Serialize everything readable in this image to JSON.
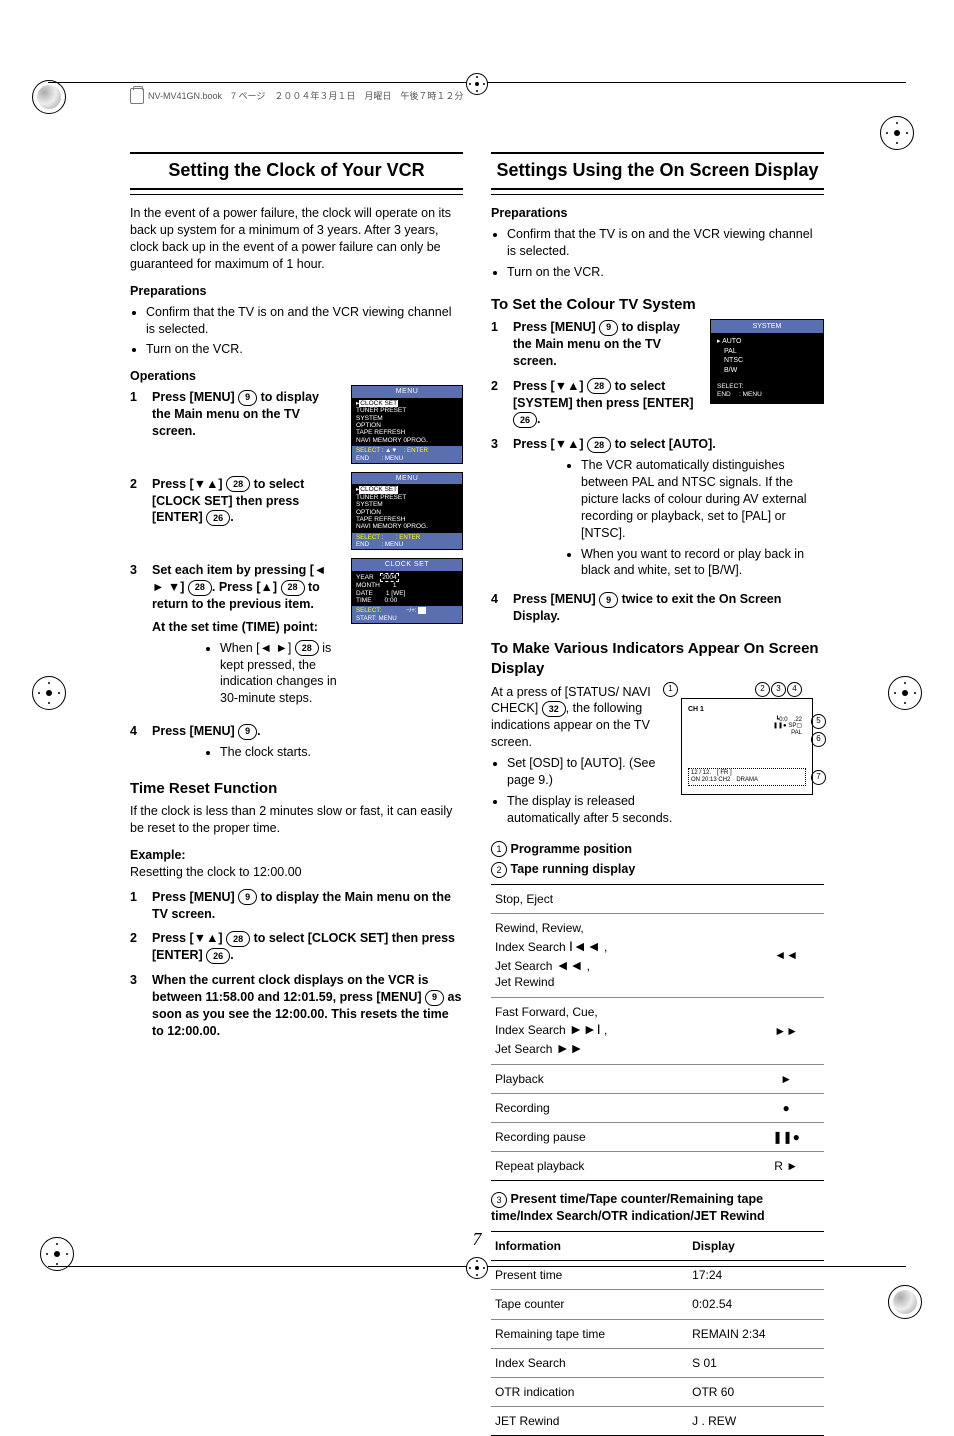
{
  "book_header": "NV-MV41GN.book　7 ページ　２００４年３月１日　月曜日　午後７時１２分",
  "page_number": "7",
  "left": {
    "title": "Setting the Clock of Your VCR",
    "intro": "In the event of a power failure, the clock will operate on its back up system for a minimum of 3 years. After 3 years, clock back up in the event of a power failure can only be guaranteed for maximum of 1 hour.",
    "prep_heading": "Preparations",
    "prep_items": [
      "Confirm that the TV is on and the VCR viewing channel is selected.",
      "Turn on the VCR."
    ],
    "ops_heading": "Operations",
    "steps": [
      {
        "num": "1",
        "textA": "Press [MENU] ",
        "btn": "9",
        "textB": " to display the Main menu on the TV screen."
      },
      {
        "num": "2",
        "textA": "Press [▼▲] ",
        "btn": "28",
        "textB": " to select [CLOCK SET] then press [ENTER] ",
        "btn2": "26",
        "textC": "."
      },
      {
        "num": "3",
        "textA": "Set each item by pressing [◄ ► ▼] ",
        "btn": "28",
        "textB": ". Press [▲] ",
        "btn2": "28",
        "textC": " to return to the previous item.",
        "subhead": "At the set time (TIME) point:",
        "subnote_a": "When [◄ ►] ",
        "subbtn": "28",
        "subnote_b": " is kept pressed, the indication changes in 30-minute steps."
      },
      {
        "num": "4",
        "textA": "Press [MENU] ",
        "btn": "9",
        "textB": ".",
        "subnote": "The clock starts."
      }
    ],
    "time_reset_heading": "Time Reset Function",
    "time_reset_body": "If the clock is less than 2 minutes slow or fast, it can easily be reset to the proper time.",
    "example_heading": "Example:",
    "example_desc": "Resetting the clock to 12:00.00",
    "example_steps": [
      {
        "num": "1",
        "a": "Press [MENU] ",
        "btn": "9",
        "b": " to display the Main menu on the TV screen."
      },
      {
        "num": "2",
        "a": "Press [▼▲] ",
        "btn": "28",
        "b": " to select [CLOCK SET] then press [ENTER] ",
        "btn2": "26",
        "c": "."
      },
      {
        "num": "3",
        "a": "When the current clock displays on the VCR is between 11:58.00 and 12:01.59, press [MENU] ",
        "btn": "9",
        "b": " as soon as you see the 12:00.00. This resets the time to 12:00.00."
      }
    ],
    "menu1": {
      "title": "MENU",
      "items": [
        "CLOCK SET",
        "TUNER PRESET",
        "SYSTEM",
        "OPTION",
        "TAPE REFRESH",
        "NAVI MEMORY 0PROG."
      ],
      "foot": [
        "SELECT : ▲▼　: ENTER",
        "END　　: MENU"
      ]
    },
    "menu2": {
      "title": "MENU",
      "items": [
        "CLOCK SET",
        "TUNER PRESET",
        "SYSTEM",
        "OPTION",
        "TAPE REFRESH",
        "NAVI MEMORY 0PROG."
      ],
      "foot": [
        "SELECT :　　: ENTER",
        "END　　: MENU"
      ]
    },
    "clockset": {
      "title": "CLOCK  SET",
      "rows": [
        [
          "YEAR",
          "2004"
        ],
        [
          "MONTH",
          "1"
        ],
        [
          "DATE",
          "1 [WE]"
        ],
        [
          "TIME",
          "0:00"
        ]
      ],
      "foot": [
        "SELECT:　　　　−/+:",
        "START: MENU"
      ]
    }
  },
  "right": {
    "title": "Settings Using the On Screen Display",
    "prep_heading": "Preparations",
    "prep_items": [
      "Confirm that the TV is on and the VCR viewing channel is selected.",
      "Turn on the VCR."
    ],
    "colour_heading": "To Set the Colour TV System",
    "colour_steps": [
      {
        "num": "1",
        "a": "Press [MENU] ",
        "btn": "9",
        "b": " to display the Main menu on the TV screen."
      },
      {
        "num": "2",
        "a": "Press [▼▲] ",
        "btn": "28",
        "b": " to select [SYSTEM] then press [ENTER] ",
        "btn2": "26",
        "c": "."
      },
      {
        "num": "3",
        "a": "Press [▼▲] ",
        "btn": "28",
        "b": " to  select [AUTO].",
        "subs": [
          "The VCR automatically distinguishes between PAL and NTSC signals. If the picture lacks of colour during AV external recording or playback, set to [PAL] or [NTSC].",
          "When you want to record or play back in black and white, set to [B/W]."
        ]
      },
      {
        "num": "4",
        "a": "Press [MENU] ",
        "btn": "9",
        "b": " twice to exit the On Screen Display."
      }
    ],
    "sysbox": {
      "title": "SYSTEM",
      "items": [
        "AUTO",
        "PAL",
        "NTSC",
        "B/W"
      ],
      "foot": [
        "SELECT:",
        "END　  : MENU"
      ]
    },
    "indic_heading": "To Make Various Indicators Appear On Screen Display",
    "indic_p1a": "At a press of [STATUS/ NAVI CHECK] ",
    "indic_btn": "32",
    "indic_p1b": ", the following indications appear on the TV screen.",
    "indic_bullets": [
      "Set [OSD] to [AUTO]. (See page 9.)",
      "The display is released automatically after 5 seconds."
    ],
    "osd_labels": {
      "ch": "CH 1",
      "counter": "0:0",
      "idx": ".22",
      "sp": "SP",
      "pal": "PAL",
      "row2": "12 / 12.　[ FR ]",
      "row3": "ON  20:13  CH2　DRAMA"
    },
    "legend": [
      {
        "n": "1",
        "t": "Programme position"
      },
      {
        "n": "2",
        "t": "Tape running display"
      }
    ],
    "tape_table": [
      {
        "l": "Stop, Eject",
        "s": ""
      },
      {
        "l_html": "<span>Rewind, Review,<br>Index Search <span class='sym'>I◄◄</span> ,<br>Jet Search <span class='sym'>◄◄</span> ,<br>Jet Rewind</span>",
        "s": "◄◄"
      },
      {
        "l_html": "<span>Fast Forward, Cue,<br>Index Search <span class='sym'>►►I</span> ,<br>Jet Search <span class='sym'>►►</span></span>",
        "s": "►►"
      },
      {
        "l": "Playback",
        "s": "►"
      },
      {
        "l": "Recording",
        "s": "●"
      },
      {
        "l": "Recording pause",
        "s": "❚❚●"
      },
      {
        "l": "Repeat playback",
        "s": "R ►"
      }
    ],
    "legend3": {
      "n": "3",
      "t": "Present time/Tape counter/Remaining tape time/Index Search/OTR indication/JET Rewind"
    },
    "info_table": {
      "head": [
        "Information",
        "Display"
      ],
      "rows": [
        [
          "Present time",
          "17:24"
        ],
        [
          "Tape counter",
          "0:02.54"
        ],
        [
          "Remaining tape time",
          "REMAIN 2:34"
        ],
        [
          "Index Search",
          "S 01"
        ],
        [
          "OTR indication",
          "OTR 60"
        ],
        [
          "JET Rewind",
          "J . REW"
        ]
      ]
    }
  }
}
